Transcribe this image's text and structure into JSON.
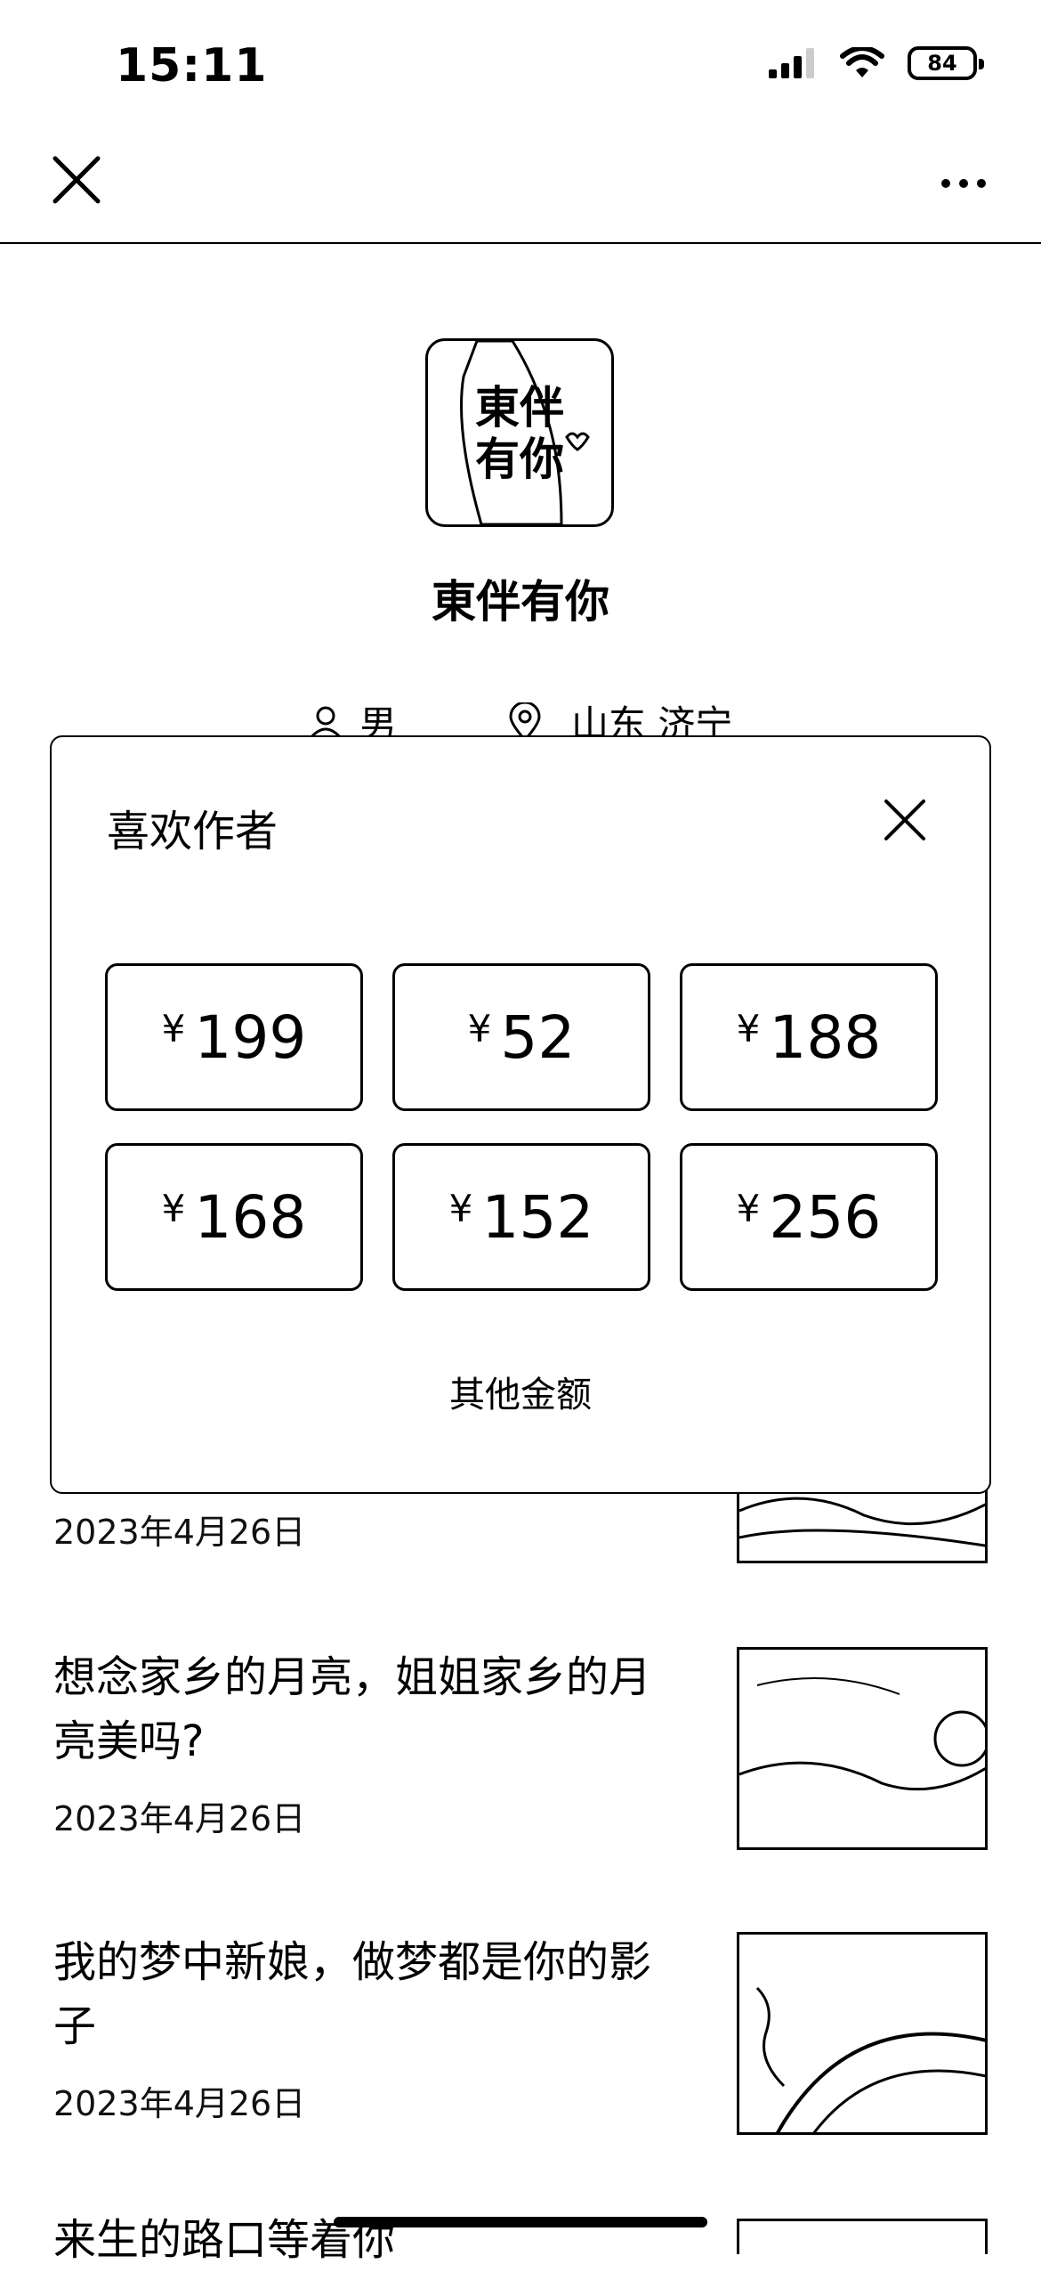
{
  "status_bar": {
    "time": "15:11",
    "battery": "84"
  },
  "nav": {
    "close_icon": "close-icon",
    "more_icon": "more-icon"
  },
  "profile": {
    "avatar_text_line1": "東伴",
    "avatar_text_line2": "有你",
    "name": "東伴有你",
    "gender": "男",
    "location": "山东 济宁"
  },
  "articles": [
    {
      "title": "",
      "date": "2023年4月26日"
    },
    {
      "title": "想念家乡的月亮，姐姐家乡的月亮美吗?",
      "date": "2023年4月26日"
    },
    {
      "title": "我的梦中新娘，做梦都是你的影子",
      "date": "2023年4月26日"
    },
    {
      "title": "来生的路口等着你",
      "date": ""
    }
  ],
  "modal": {
    "title": "喜欢作者",
    "currency": "¥",
    "amounts": [
      "199",
      "52",
      "188",
      "168",
      "152",
      "256"
    ],
    "other_label": "其他金额"
  }
}
